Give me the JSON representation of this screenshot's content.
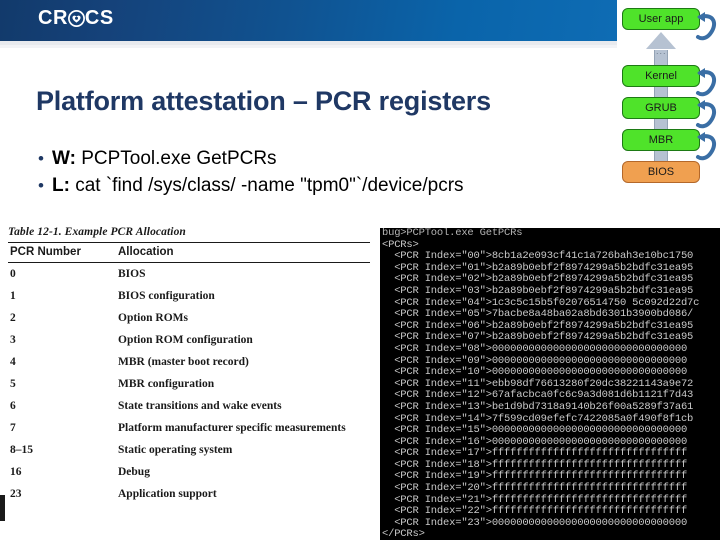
{
  "header": {
    "logo_left": "CR",
    "logo_mark": "crocs-shield-icon",
    "logo_right": "CS"
  },
  "slide": {
    "title": "Platform attestation – PCR registers",
    "bullets": [
      {
        "marker": "•",
        "label": "W:",
        "text": " PCPTool.exe GetPCRs"
      },
      {
        "marker": "•",
        "label": "L:",
        "text": " cat `find /sys/class/ -name \"tpm0\"`/device/pcrs"
      }
    ]
  },
  "boot_chain": {
    "boxes": [
      {
        "label": "User app",
        "color": "#4fe32a",
        "kind": "green"
      },
      {
        "label": "Kernel",
        "color": "#4fe32a",
        "kind": "green"
      },
      {
        "label": "GRUB",
        "color": "#4fe32a",
        "kind": "green"
      },
      {
        "label": "MBR",
        "color": "#4fe32a",
        "kind": "green"
      },
      {
        "label": "BIOS",
        "color": "#f0a050",
        "kind": "orange"
      }
    ],
    "ellipsis": "...",
    "arrow_icon": "up-arrow-icon",
    "measure_arrow_icon": "curved-measure-arrow-icon",
    "measure_arrow_count": 4
  },
  "pcr_table": {
    "caption": "Table 12-1.  Example PCR Allocation",
    "columns": [
      "PCR Number",
      "Allocation"
    ],
    "rows": [
      {
        "num": "0",
        "alloc": "BIOS"
      },
      {
        "num": "1",
        "alloc": "BIOS configuration"
      },
      {
        "num": "2",
        "alloc": "Option ROMs"
      },
      {
        "num": "3",
        "alloc": "Option ROM configuration"
      },
      {
        "num": "4",
        "alloc": "MBR (master boot record)"
      },
      {
        "num": "5",
        "alloc": "MBR configuration"
      },
      {
        "num": "6",
        "alloc": "State transitions and wake events"
      },
      {
        "num": "7",
        "alloc": "Platform manufacturer specific measurements"
      },
      {
        "num": "8–15",
        "alloc": "Static operating system"
      },
      {
        "num": "16",
        "alloc": "Debug"
      },
      {
        "num": "23",
        "alloc": "Application support"
      }
    ]
  },
  "terminal": {
    "lines": [
      "bug>PCPTool.exe GetPCRs",
      "<PCRs>",
      "  <PCR Index=\"00\">8cb1a2e093cf41c1a726bah3e10bc1750",
      "  <PCR Index=\"01\">b2a89b0ebf2f8974299a5b2bdfc31ea95",
      "  <PCR Index=\"02\">b2a89b0ebf2f8974299a5b2bdfc31ea95",
      "  <PCR Index=\"03\">b2a89b0ebf2f8974299a5b2bdfc31ea95",
      "  <PCR Index=\"04\">1c3c5c15b5f02076514750 5c092d22d7c",
      "  <PCR Index=\"05\">7bacbe8a48ba02a8bd6301b3900bd086/",
      "  <PCR Index=\"06\">b2a89b0ebf2f8974299a5b2bdfc31ea95",
      "  <PCR Index=\"07\">b2a89b0ebf2f8974299a5b2bdfc31ea95",
      "  <PCR Index=\"08\">00000000000000000000000000000000",
      "  <PCR Index=\"09\">00000000000000000000000000000000",
      "  <PCR Index=\"10\">00000000000000000000000000000000",
      "  <PCR Index=\"11\">ebb98df76613280f20dc38221143a9e72",
      "  <PCR Index=\"12\">67afacbca0fc6c9a3d081d6b1121f7d43",
      "  <PCR Index=\"13\">be1d9bd7318a9140b26f00a5289f37a61",
      "  <PCR Index=\"14\">7f599cd09efefc7422085a0f490f8f1cb",
      "  <PCR Index=\"15\">00000000000000000000000000000000",
      "  <PCR Index=\"16\">00000000000000000000000000000000",
      "  <PCR Index=\"17\">ffffffffffffffffffffffffffffffff",
      "  <PCR Index=\"18\">ffffffffffffffffffffffffffffffff",
      "  <PCR Index=\"19\">ffffffffffffffffffffffffffffffff",
      "  <PCR Index=\"20\">ffffffffffffffffffffffffffffffff",
      "  <PCR Index=\"21\">ffffffffffffffffffffffffffffffff",
      "  <PCR Index=\"22\">ffffffffffffffffffffffffffffffff",
      "  <PCR Index=\"23\">00000000000000000000000000000000",
      "</PCRs>"
    ]
  },
  "colors": {
    "header_dark": "#123a6b",
    "header_light": "#0e6cb4",
    "title_blue": "#1f3864",
    "chain_green": "#4fe32a",
    "chain_orange": "#f0a050",
    "arrow_blue": "#3a6ea5",
    "arrow_gray": "#b6c2d2"
  }
}
